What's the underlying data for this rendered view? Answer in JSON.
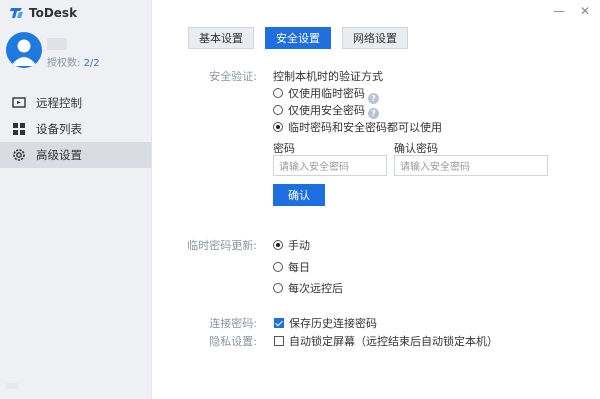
{
  "app": {
    "name": "ToDesk"
  },
  "sidebar": {
    "license_label": "授权数:",
    "license_value": "2/2",
    "items": [
      {
        "label": "远程控制",
        "icon": "monitor-icon"
      },
      {
        "label": "设备列表",
        "icon": "grid-icon"
      },
      {
        "label": "高级设置",
        "icon": "gear-icon",
        "active": true
      }
    ]
  },
  "window": {
    "minimize": "—",
    "close": "✕"
  },
  "tabs": [
    {
      "label": "基本设置"
    },
    {
      "label": "安全设置",
      "active": true
    },
    {
      "label": "网络设置"
    }
  ],
  "security": {
    "label": "安全验证:",
    "desc": "控制本机时的验证方式",
    "options": [
      {
        "label": "仅使用临时密码",
        "checked": false
      },
      {
        "label": "仅使用安全密码",
        "checked": false
      },
      {
        "label": "临时密码和安全密码都可以使用",
        "checked": true
      }
    ],
    "help_glyph": "?",
    "password_label": "密码",
    "confirm_label": "确认密码",
    "password_placeholder": "请输入安全密码",
    "confirm_placeholder": "请输入安全密码",
    "confirm_button": "确认"
  },
  "temp_password": {
    "label": "临时密码更新:",
    "options": [
      {
        "label": "手动",
        "checked": true
      },
      {
        "label": "每日",
        "checked": false
      },
      {
        "label": "每次远控后",
        "checked": false
      }
    ]
  },
  "connection_password": {
    "label": "连接密码:",
    "option": "保存历史连接密码",
    "checked": true
  },
  "privacy": {
    "label": "隐私设置:",
    "option": "自动锁定屏幕（远控结束后自动锁定本机）",
    "checked": false
  },
  "colors": {
    "accent": "#1f6fe0",
    "sidebar_bg": "#eef0f3"
  }
}
